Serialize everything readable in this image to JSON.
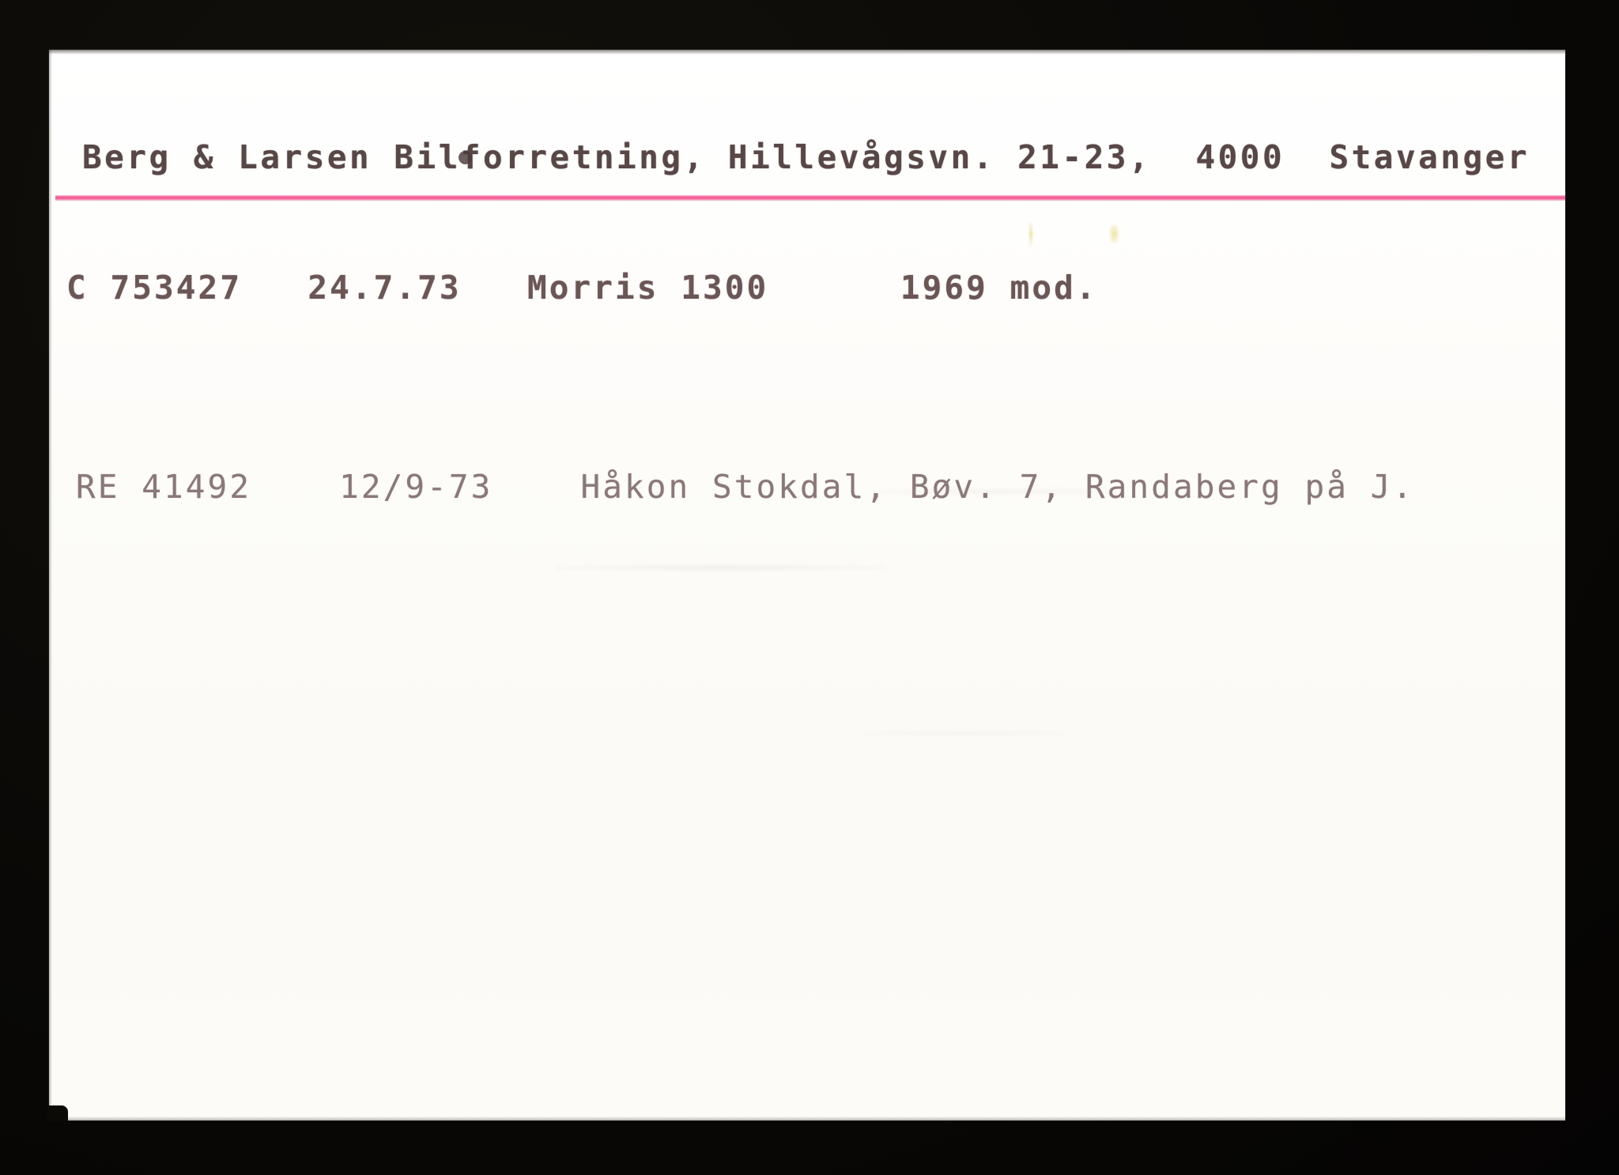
{
  "document": {
    "type": "scanned-index-card",
    "title_line": "Berg & Larsen Bilforretning, Hillevågsvn. 21-23,  4000  Stavanger",
    "business": {
      "name": "Berg & Larsen Bilforretning",
      "street": "Hillevågsvn. 21-23",
      "postal_code": "4000",
      "city": "Stavanger"
    },
    "records": [
      {
        "registration": "C 753427",
        "date": "24.7.73",
        "description": "Morris 1300",
        "model_year": "1969 mod.",
        "text": "C 753427   24.7.73   Morris 1300      1969 mod."
      },
      {
        "registration": "RE 41492",
        "date": "12/9-73",
        "description": "Håkon Stokdal, Bøv. 7, Randaberg på J.",
        "text": "RE 41492    12/9-73    Håkon Stokdal, Bøv. 7, Randaberg på J."
      }
    ],
    "rule": {
      "name": "pink-horizontal-rule",
      "color": "#ef5a92"
    },
    "colors": {
      "backdrop": "#0a0906",
      "card": "#fdfcfa",
      "header_ink": "#584747",
      "record_ink_strong": "#6b5656",
      "record_ink_faint": "#8a7878",
      "rule_pink": "#ef5a92"
    },
    "artifacts": {
      "overstrike_note": "overstruck character in Bilforretning",
      "yellow_specks": "faint yellow scanner specks below rule"
    }
  }
}
